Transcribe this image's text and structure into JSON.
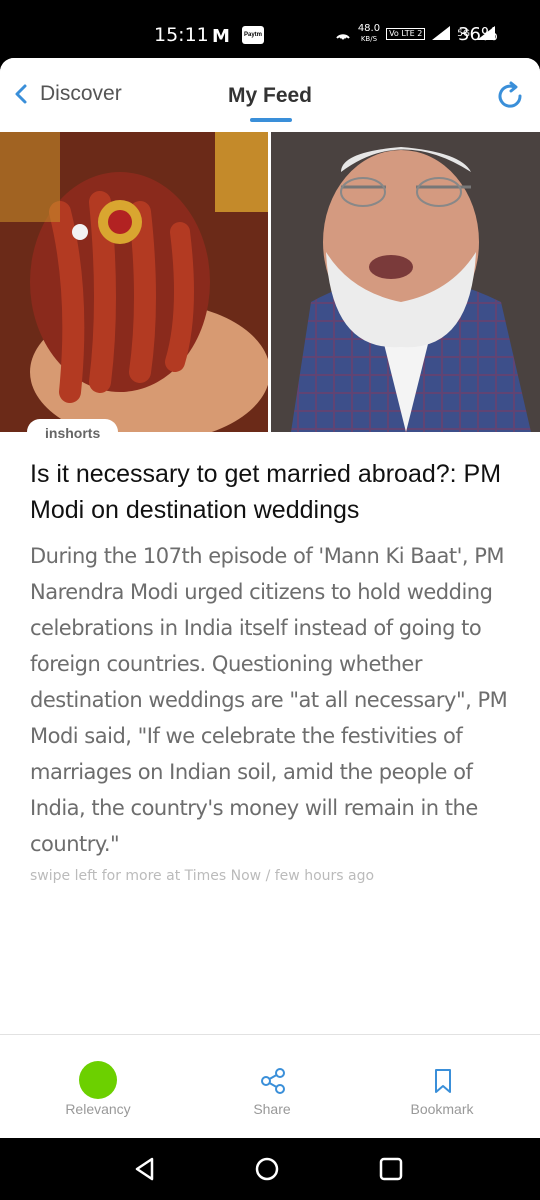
{
  "status": {
    "time": "15:11",
    "mail_icon": "M",
    "paytm_icon": "Paytm",
    "net_speed": "48.0",
    "net_unit": "KB/S",
    "volte": "Vo LTE 2",
    "network": "5G",
    "battery": "36%"
  },
  "nav": {
    "back_label": "Discover",
    "title": "My Feed",
    "accent_color": "#3a8fd9"
  },
  "article": {
    "source_tag": "inshorts",
    "headline": "Is it necessary to get married abroad?: PM Modi on destination weddings",
    "body": "During the 107th episode of 'Mann Ki Baat', PM Narendra Modi urged citizens to hold wedding celebrations in India itself instead of going to foreign countries. Questioning whether destination weddings are \"at all necessary\", PM Modi said, \"If we celebrate the festivities of marriages on Indian soil, amid the people of India, the country's money will remain in the country.\"",
    "footer": "swipe left for more at Times Now / few hours ago"
  },
  "bottom_tabs": {
    "relevancy": "Relevancy",
    "share": "Share",
    "bookmark": "Bookmark",
    "relevancy_color": "#6cd000"
  },
  "icons": {
    "back": "chevron-left-icon",
    "refresh": "refresh-icon",
    "share": "share-icon",
    "bookmark": "bookmark-icon"
  }
}
